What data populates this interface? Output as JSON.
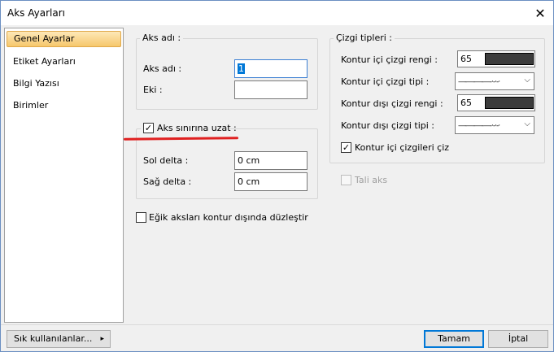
{
  "window": {
    "title": "Aks Ayarları",
    "close_glyph": "✕"
  },
  "sidebar": {
    "items": [
      {
        "label": "Genel Ayarlar",
        "selected": true
      },
      {
        "label": "Etiket Ayarları"
      },
      {
        "label": "Bilgi Yazısı"
      },
      {
        "label": "Birimler"
      }
    ]
  },
  "aks_adi_group": {
    "legend": "Aks adı :",
    "name_label": "Aks adı :",
    "name_value": "1",
    "eki_label": "Eki :",
    "eki_value": ""
  },
  "extend_group": {
    "checkbox_label": "Aks sınırına uzat :",
    "checked": true,
    "sol_label": "Sol delta :",
    "sol_value": "0 cm",
    "sag_label": "Sağ delta :",
    "sag_value": "0 cm"
  },
  "egik_checkbox": {
    "label": "Eğik aksları kontur dışında düzleştir",
    "checked": false
  },
  "cizgi_group": {
    "legend": "Çizgi tipleri :",
    "kontur_ici_renk_label": "Kontur içi çizgi rengi :",
    "kontur_ici_renk_value": "65",
    "kontur_ici_tip_label": "Kontur içi çizgi tipi :",
    "kontur_disi_renk_label": "Kontur dışı çizgi rengi :",
    "kontur_disi_renk_value": "65",
    "kontur_disi_tip_label": "Kontur dışı çizgi tipi :",
    "line_pattern": "—-—-—-—-·-·-·",
    "dropdown_glyph": "⌵",
    "ciz_checkbox_label": "Kontur içi çizgileri çiz",
    "ciz_checked": true
  },
  "tali_aks": {
    "label": "Tali aks",
    "checked": false,
    "disabled": true
  },
  "footer": {
    "frequent_label": "Sık kullanılanlar...",
    "frequent_arrow": "▸",
    "ok_label": "Tamam",
    "cancel_label": "İptal"
  },
  "colors": {
    "accent": "#0078d7",
    "selection": "#f6c76c",
    "annotation": "#e02020",
    "swatch": "#3c3c3c"
  },
  "check_glyph": "✓"
}
